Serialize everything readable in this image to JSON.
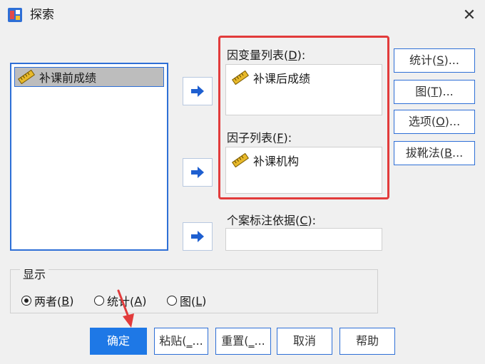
{
  "window": {
    "title": "探索",
    "close_glyph": "✕"
  },
  "source_list": {
    "items": [
      {
        "label": "补课前成绩"
      }
    ]
  },
  "dependent_list": {
    "label_prefix": "因变量列表(",
    "label_key": "D",
    "label_suffix": "):",
    "items": [
      {
        "label": "补课后成绩"
      }
    ]
  },
  "factor_list": {
    "label_prefix": "因子列表(",
    "label_key": "F",
    "label_suffix": "):",
    "items": [
      {
        "label": "补课机构"
      }
    ]
  },
  "case_label": {
    "label_prefix": "个案标注依据(",
    "label_key": "C",
    "label_suffix": "):",
    "value": ""
  },
  "side_buttons": [
    {
      "prefix": "统计(",
      "key": "S",
      "suffix": ")..."
    },
    {
      "prefix": "图(",
      "key": "T",
      "suffix": ")..."
    },
    {
      "prefix": "选项(",
      "key": "O",
      "suffix": ")..."
    },
    {
      "prefix": "拔靴法(",
      "key": "B",
      "suffix": "..."
    }
  ],
  "display": {
    "label": "显示",
    "options": [
      {
        "prefix": "两者(",
        "key": "B",
        "suffix": ")",
        "selected": true
      },
      {
        "prefix": "统计(",
        "key": "A",
        "suffix": ")",
        "selected": false
      },
      {
        "prefix": "图(",
        "key": "L",
        "suffix": ")",
        "selected": false
      }
    ]
  },
  "bottom_buttons": {
    "ok": "确定",
    "paste": {
      "prefix": "粘贴(",
      "key": "_",
      "suffix": "..."
    },
    "reset": {
      "prefix": "重置(",
      "key": "_",
      "suffix": "..."
    },
    "cancel": "取消",
    "help": "帮助"
  },
  "colors": {
    "accent": "#2e6fd6",
    "ok_button": "#1e78e6",
    "highlight_box": "#e23b3b",
    "annotation_arrow": "#e23b3b"
  },
  "icons": {
    "variable": "ruler-icon",
    "move": "arrow-right-icon",
    "app": "app-icon"
  }
}
